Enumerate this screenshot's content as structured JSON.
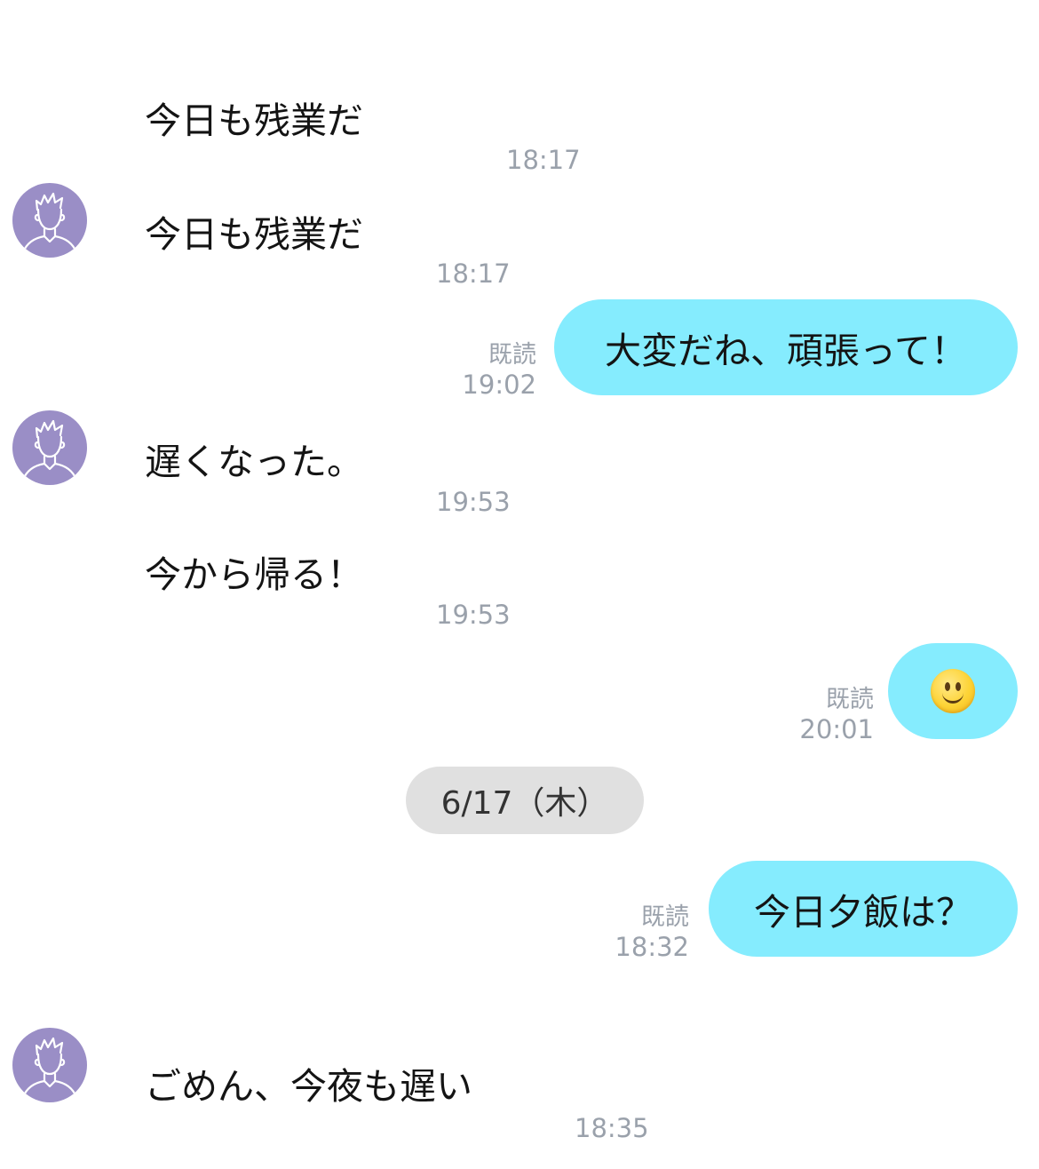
{
  "colors": {
    "outgoing_bubble": "#85ecfe",
    "avatar_bg": "#9a8ec6",
    "timestamp": "#9aa1ab",
    "date_pill_bg": "#e0e0e0"
  },
  "messages": [
    {
      "side": "in",
      "show_avatar": false,
      "text": "今日も残業だ",
      "time": "18:17"
    },
    {
      "side": "in",
      "show_avatar": true,
      "text": "今日も残業だ",
      "time": "18:17"
    },
    {
      "side": "out",
      "text": "大変だね、頑張って！",
      "read": "既読",
      "time": "19:02"
    },
    {
      "side": "in",
      "show_avatar": true,
      "text": "遅くなった。",
      "time": "19:53"
    },
    {
      "side": "in",
      "show_avatar": false,
      "text": "今から帰る！",
      "time": "19:53"
    },
    {
      "side": "out",
      "emoji": "slightly-smiling-face-icon",
      "read": "既読",
      "time": "20:01"
    },
    {
      "side": "in",
      "show_avatar": true,
      "text": "ごめん、今夜も遅い",
      "time": "18:35"
    },
    {
      "side": "out",
      "text": "今日夕飯は？",
      "read": "既読",
      "time": "18:32"
    }
  ],
  "date_separator": {
    "label": "6/17（木）"
  }
}
